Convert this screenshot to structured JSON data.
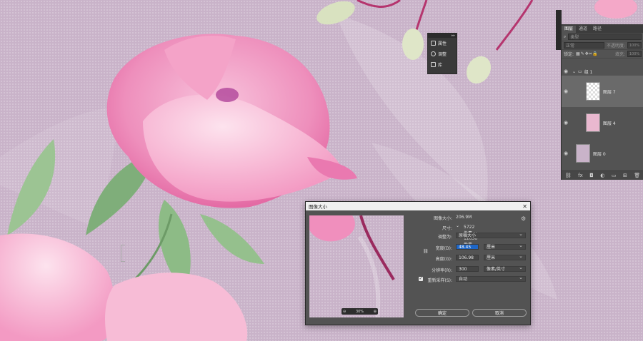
{
  "mini_panel": {
    "items": [
      {
        "label": "属性",
        "icon": "properties-icon"
      },
      {
        "label": "调整",
        "icon": "adjustments-icon"
      },
      {
        "label": "库",
        "icon": "libraries-icon"
      }
    ]
  },
  "layers_panel": {
    "tabs": [
      "图层",
      "通道",
      "路径"
    ],
    "kind_placeholder": "类型",
    "blend_mode": "正常",
    "opacity_label": "不透明度:",
    "opacity_value": "100%",
    "lock_label": "锁定:",
    "fill_label": "填充:",
    "fill_value": "100%",
    "group_name": "组 1",
    "layers": [
      "图层 7",
      "图层 4",
      "图层 0"
    ]
  },
  "dialog": {
    "title": "图像大小",
    "image_size_label": "图像大小:",
    "image_size_value": "206.9M",
    "dimensions_label": "尺寸:",
    "dimensions_value": "5722 像素 × 12636 像素",
    "fit_label": "调整为:",
    "fit_value": "原稿大小",
    "width_label": "宽度(D):",
    "width_value": "48.45",
    "width_unit": "厘米",
    "height_label": "高度(G):",
    "height_value": "106.98",
    "height_unit": "厘米",
    "resolution_label": "分辨率(R):",
    "resolution_value": "300",
    "resolution_unit": "像素/英寸",
    "resample_label": "重新采样(S):",
    "resample_value": "自动",
    "resample_checked": true,
    "zoom_value": "30%",
    "ok_label": "确定",
    "cancel_label": "取消"
  }
}
